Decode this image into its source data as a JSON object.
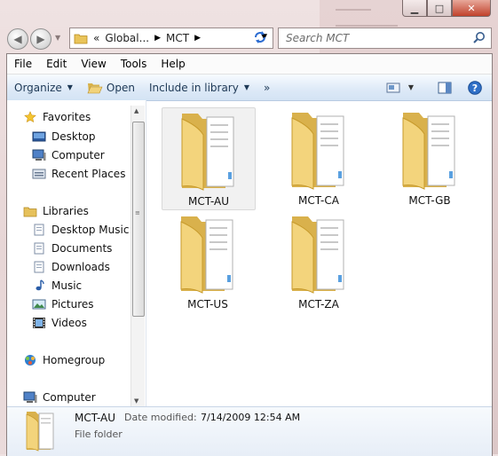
{
  "address": {
    "breadcrumbs": [
      "«",
      "Global...",
      "MCT"
    ],
    "search_placeholder": "Search MCT"
  },
  "menubar": [
    "File",
    "Edit",
    "View",
    "Tools",
    "Help"
  ],
  "toolbar": {
    "organize": "Organize",
    "open": "Open",
    "include_in_library": "Include in library",
    "more": "»"
  },
  "navpane": {
    "favorites": {
      "title": "Favorites",
      "items": [
        "Desktop",
        "Computer",
        "Recent Places"
      ]
    },
    "libraries": {
      "title": "Libraries",
      "items": [
        "Desktop Music",
        "Documents",
        "Downloads",
        "Music",
        "Pictures",
        "Videos"
      ]
    },
    "homegroup": "Homegroup",
    "computer": "Computer"
  },
  "folders": [
    {
      "name": "MCT-AU",
      "selected": true
    },
    {
      "name": "MCT-CA",
      "selected": false
    },
    {
      "name": "MCT-GB",
      "selected": false
    },
    {
      "name": "MCT-US",
      "selected": false
    },
    {
      "name": "MCT-ZA",
      "selected": false
    }
  ],
  "details": {
    "name": "MCT-AU",
    "date_modified_label": "Date modified:",
    "date_modified_value": "7/14/2009 12:54 AM",
    "type": "File folder"
  }
}
